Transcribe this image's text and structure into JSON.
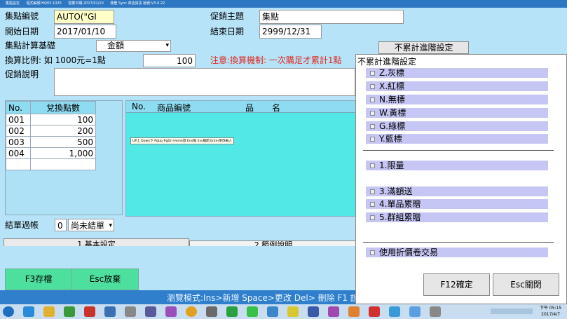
{
  "topbar": [
    "集點設定",
    "程式編號:HQ03.1020",
    "營業日期:2017/01/10",
    "鼎聖 Sync 商店資訊 版號:V3.0.22"
  ],
  "form": {
    "code_label": "集點編號",
    "code_value": "AUTO(\"GI",
    "theme_label": "促銷主題",
    "theme_value": "集點",
    "start_label": "開始日期",
    "start_value": "2017/01/10",
    "end_label": "結束日期",
    "end_value": "2999/12/31",
    "basis_label": "集點計算基礎",
    "basis_value": "金額",
    "ratio_label": "換算比例: 如 1000元=1點",
    "ratio_value": "100",
    "warning": "注意:換算機制: 一次購足才累計1點",
    "desc_label": "促銷說明",
    "adv_button": "不累計進階設定"
  },
  "points_table": {
    "headers": [
      "No.",
      "兌換點數"
    ],
    "rows": [
      [
        "001",
        "100"
      ],
      [
        "002",
        "200"
      ],
      [
        "003",
        "500"
      ],
      [
        "004",
        "1,000"
      ]
    ]
  },
  "product_table": {
    "headers": [
      "No.",
      "商品編號",
      "品",
      "名"
    ],
    "hint": "UP上 Down下 PgUp PgDn Home首 End尾 Esc離開 Enter更改輸入"
  },
  "settle": {
    "label": "結單過帳",
    "value": "0",
    "status": "尚未結單"
  },
  "tabs": [
    "1.基本設定",
    "2.範例說明"
  ],
  "buttons": {
    "save": "F3存檔",
    "cancel": "Esc放棄"
  },
  "status_bar": "瀏覽模式:Ins>新增 Space>更改 Del> 刪除  F1 說",
  "panel": {
    "title": "不累計進階設定",
    "group1": [
      "Z.灰標",
      "X.紅標",
      "N.無標",
      "W.黃標",
      "G.綠標",
      "Y.藍標"
    ],
    "group2": [
      "1.限量",
      "3.滿額送",
      "4.單品累贈",
      "5.群組累贈"
    ],
    "group3": [
      "使用折價卷交易"
    ],
    "ok": "F12確定",
    "close": "Esc關閉"
  },
  "tray": {
    "time": "下午 05:15",
    "date": "2017/4/7"
  }
}
